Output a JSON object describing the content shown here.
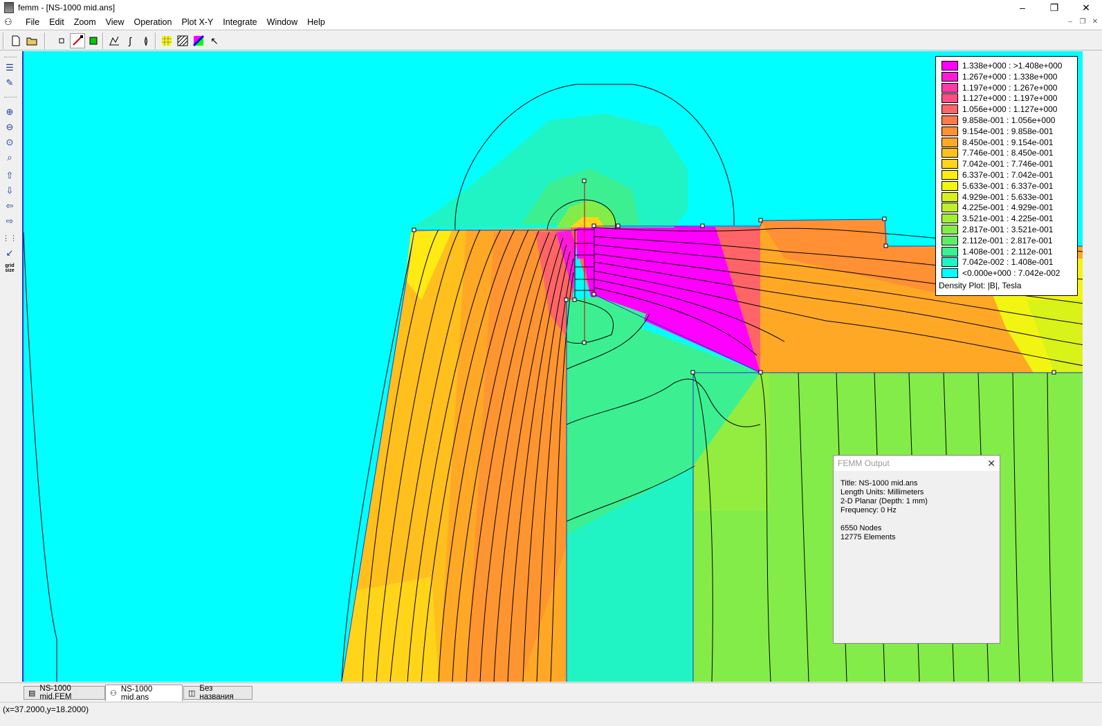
{
  "window": {
    "title": "femm - [NS-1000 mid.ans]",
    "controls": [
      "–",
      "❐",
      "✕"
    ],
    "mdi_controls": [
      "–",
      "❐",
      "✕"
    ]
  },
  "menu": [
    "File",
    "Edit",
    "Zoom",
    "View",
    "Operation",
    "Plot X-Y",
    "Integrate",
    "Window",
    "Help"
  ],
  "toolbar": {
    "new_icon": "new-file-icon",
    "open_icon": "open-folder-icon"
  },
  "sidebar": {
    "grid_size_label": "grid\nsize"
  },
  "legend": {
    "title": "Density Plot: |B|, Tesla",
    "entries": [
      {
        "label": "1.338e+000 : >1.408e+000",
        "color": "#ff00ff"
      },
      {
        "label": "1.267e+000 : 1.338e+000",
        "color": "#ff1ad8"
      },
      {
        "label": "1.197e+000 : 1.267e+000",
        "color": "#ff3aa8"
      },
      {
        "label": "1.127e+000 : 1.197e+000",
        "color": "#ff4e86"
      },
      {
        "label": "1.056e+000 : 1.127e+000",
        "color": "#ff6566"
      },
      {
        "label": "9.858e-001 : 1.056e+000",
        "color": "#ff7a4a"
      },
      {
        "label": "9.154e-001 : 9.858e-001",
        "color": "#ff9033"
      },
      {
        "label": "8.450e-001 : 9.154e-001",
        "color": "#ffa826"
      },
      {
        "label": "7.746e-001 : 8.450e-001",
        "color": "#ffbf1d"
      },
      {
        "label": "7.042e-001 : 7.746e-001",
        "color": "#ffd419"
      },
      {
        "label": "6.337e-001 : 7.042e-001",
        "color": "#ffea14"
      },
      {
        "label": "5.633e-001 : 6.337e-001",
        "color": "#f2f412"
      },
      {
        "label": "4.929e-001 : 5.633e-001",
        "color": "#d8f21a"
      },
      {
        "label": "4.225e-001 : 4.929e-001",
        "color": "#bdf02a"
      },
      {
        "label": "3.521e-001 : 4.225e-001",
        "color": "#a0ee38"
      },
      {
        "label": "2.817e-001 : 3.521e-001",
        "color": "#84ec48"
      },
      {
        "label": "2.112e-001 : 2.817e-001",
        "color": "#5eee66"
      },
      {
        "label": "1.408e-001 : 2.112e-001",
        "color": "#3cf092"
      },
      {
        "label": "7.042e-002 : 1.408e-001",
        "color": "#20f4c4"
      },
      {
        "label": "<0.000e+000 : 7.042e-002",
        "color": "#00ffff"
      }
    ]
  },
  "output": {
    "title": "FEMM Output",
    "text": "Title: NS-1000 mid.ans\nLength Units: Millimeters\n2-D Planar (Depth: 1 mm)\nFrequency: 0 Hz\n\n6550 Nodes\n12775 Elements"
  },
  "tabs": [
    {
      "label": "NS-1000 mid.FEM",
      "icon": "document-icon",
      "active": false
    },
    {
      "label": "NS-1000 mid.ans",
      "icon": "femm-icon",
      "active": true
    },
    {
      "label": "Без названия",
      "icon": "plot-icon",
      "active": false
    }
  ],
  "status": "(x=37.2000,y=18.2000)"
}
